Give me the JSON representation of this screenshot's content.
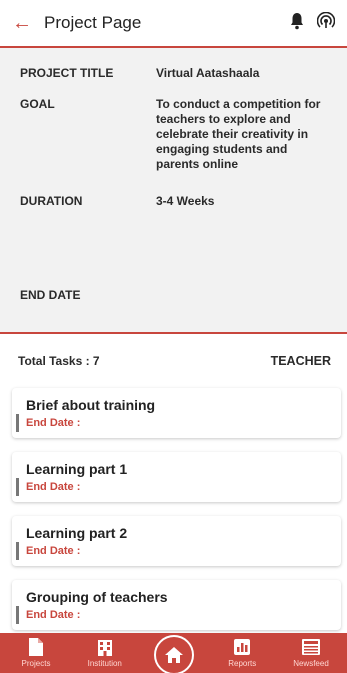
{
  "header": {
    "back_icon": "arrow-left-icon",
    "title": "Project Page",
    "bell_icon": "bell-icon",
    "broadcast_icon": "broadcast-icon"
  },
  "details": {
    "project_title_label": "PROJECT TITLE",
    "project_title_value": "Virtual Aatashaala",
    "goal_label": "GOAL",
    "goal_value": "To conduct a competition for teachers to explore and celebrate their creativity in engaging students and parents online",
    "duration_label": "DURATION",
    "duration_value": "3-4 Weeks",
    "end_date_label": "END DATE",
    "end_date_value": ""
  },
  "tasks": {
    "total_label": "Total Tasks : 7",
    "role": "TEACHER",
    "items": [
      {
        "name": "Brief about training",
        "end_label": "End Date :"
      },
      {
        "name": "Learning part 1",
        "end_label": "End Date :"
      },
      {
        "name": "Learning part 2",
        "end_label": "End Date :"
      },
      {
        "name": "Grouping of teachers",
        "end_label": "End Date :"
      }
    ]
  },
  "bottom_nav": {
    "projects": "Projects",
    "institution": "Institution",
    "home_icon": "home-icon",
    "reports": "Reports",
    "newsfeed": "Newsfeed"
  },
  "colors": {
    "accent": "#c8463d",
    "panel": "#f2f2f2"
  }
}
